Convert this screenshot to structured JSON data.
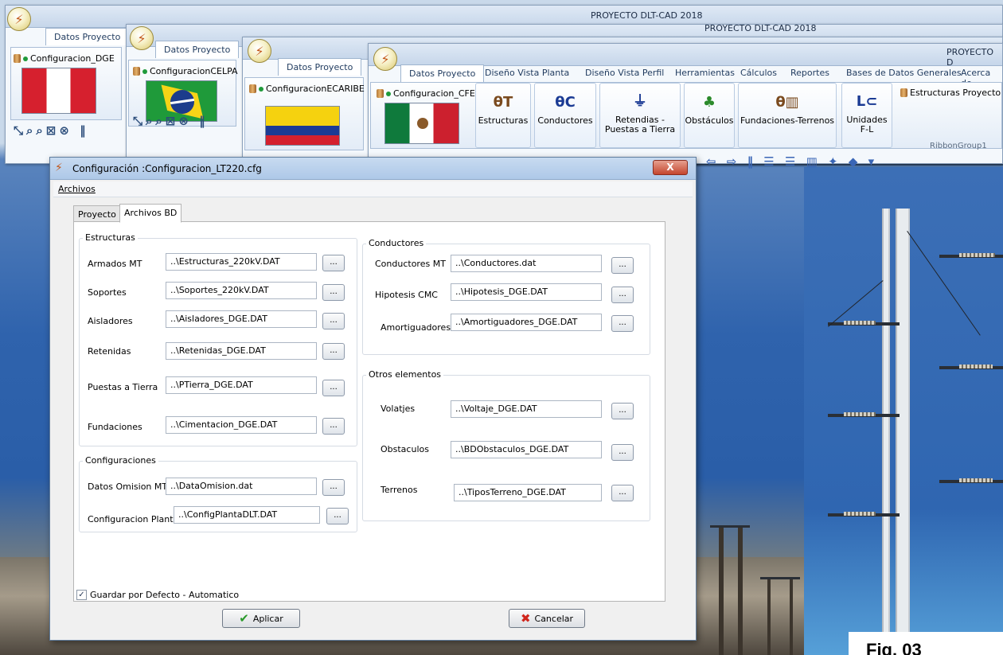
{
  "app": {
    "title": "PROYECTO DLT-CAD 2018",
    "title_2": "PROYECTO DLT-CAD 2018",
    "title_3": "PROYECTO D"
  },
  "windows": [
    {
      "tab": "Datos Proyecto",
      "config": "Configuracion_DGE",
      "flag": "Peru"
    },
    {
      "tab": "Datos Proyecto",
      "config": "ConfiguracionCELPA",
      "flag": "Brazil"
    },
    {
      "tab": "Datos Proyecto",
      "config": "ConfiguracionECARIBE",
      "flag": "Colombia"
    },
    {
      "tab": "Datos Proyecto",
      "config": "Configuracion_CFE",
      "flag": "Mexico"
    }
  ],
  "ribbon": {
    "tabs": [
      "Datos Proyecto",
      "Diseño Vista Planta",
      "Diseño Vista Perfil",
      "Herramientas",
      "Cálculos",
      "Reportes",
      "Bases de Datos Generales",
      "Acerca de"
    ],
    "buttons": [
      {
        "label": "Estructuras",
        "icon": "structure-icon"
      },
      {
        "label": "Conductores",
        "icon": "conductor-icon"
      },
      {
        "label": "Retendias - Puestas a Tierra",
        "icon": "ground-icon"
      },
      {
        "label": "Obstáculos",
        "icon": "obstacle-icon"
      },
      {
        "label": "Fundaciones-Terrenos",
        "icon": "foundation-icon"
      },
      {
        "label": "Unidades F-L",
        "icon": "units-icon"
      }
    ],
    "estructuras_link": "Estructuras Proyecto",
    "group_label": "RibbonGroup1"
  },
  "dialog": {
    "title": "Configuración :Configuracion_LT220.cfg",
    "close_label": "X",
    "menu": "Archivos",
    "tabs": [
      "Proyecto",
      "Archivos BD"
    ],
    "estructuras": {
      "legend": "Estructuras",
      "rows": [
        {
          "label": "Armados MT",
          "value": "..\\Estructuras_220kV.DAT"
        },
        {
          "label": "Soportes",
          "value": "..\\Soportes_220kV.DAT"
        },
        {
          "label": "Aisladores",
          "value": "..\\Aisladores_DGE.DAT"
        },
        {
          "label": "Retenidas",
          "value": "..\\Retenidas_DGE.DAT"
        },
        {
          "label": "Puestas a Tierra",
          "value": "..\\PTierra_DGE.DAT"
        },
        {
          "label": "Fundaciones",
          "value": "..\\Cimentacion_DGE.DAT"
        }
      ]
    },
    "configuraciones": {
      "legend": "Configuraciones",
      "rows": [
        {
          "label": "Datos Omision MT",
          "value": "..\\DataOmision.dat"
        },
        {
          "label": "Configuracion Planta",
          "value": "..\\ConfigPlantaDLT.DAT"
        }
      ]
    },
    "conductores": {
      "legend": "Conductores",
      "rows": [
        {
          "label": "Conductores MT",
          "value": "..\\Conductores.dat"
        },
        {
          "label": "Hipotesis CMC",
          "value": "..\\Hipotesis_DGE.DAT"
        },
        {
          "label": "Amortiguadores",
          "value": "..\\Amortiguadores_DGE.DAT"
        }
      ]
    },
    "otros": {
      "legend": "Otros elementos",
      "rows": [
        {
          "label": "Volatjes",
          "value": "..\\Voltaje_DGE.DAT"
        },
        {
          "label": "Obstaculos",
          "value": "..\\BDObstaculos_DGE.DAT"
        },
        {
          "label": "Terrenos",
          "value": "..\\TiposTerreno_DGE.DAT"
        }
      ]
    },
    "browse_label": "...",
    "checkbox_label": "Guardar por Defecto - Automatico",
    "checkbox_checked": true,
    "apply_label": "Aplicar",
    "cancel_label": "Cancelar"
  },
  "figure_label": "Fig. 03"
}
